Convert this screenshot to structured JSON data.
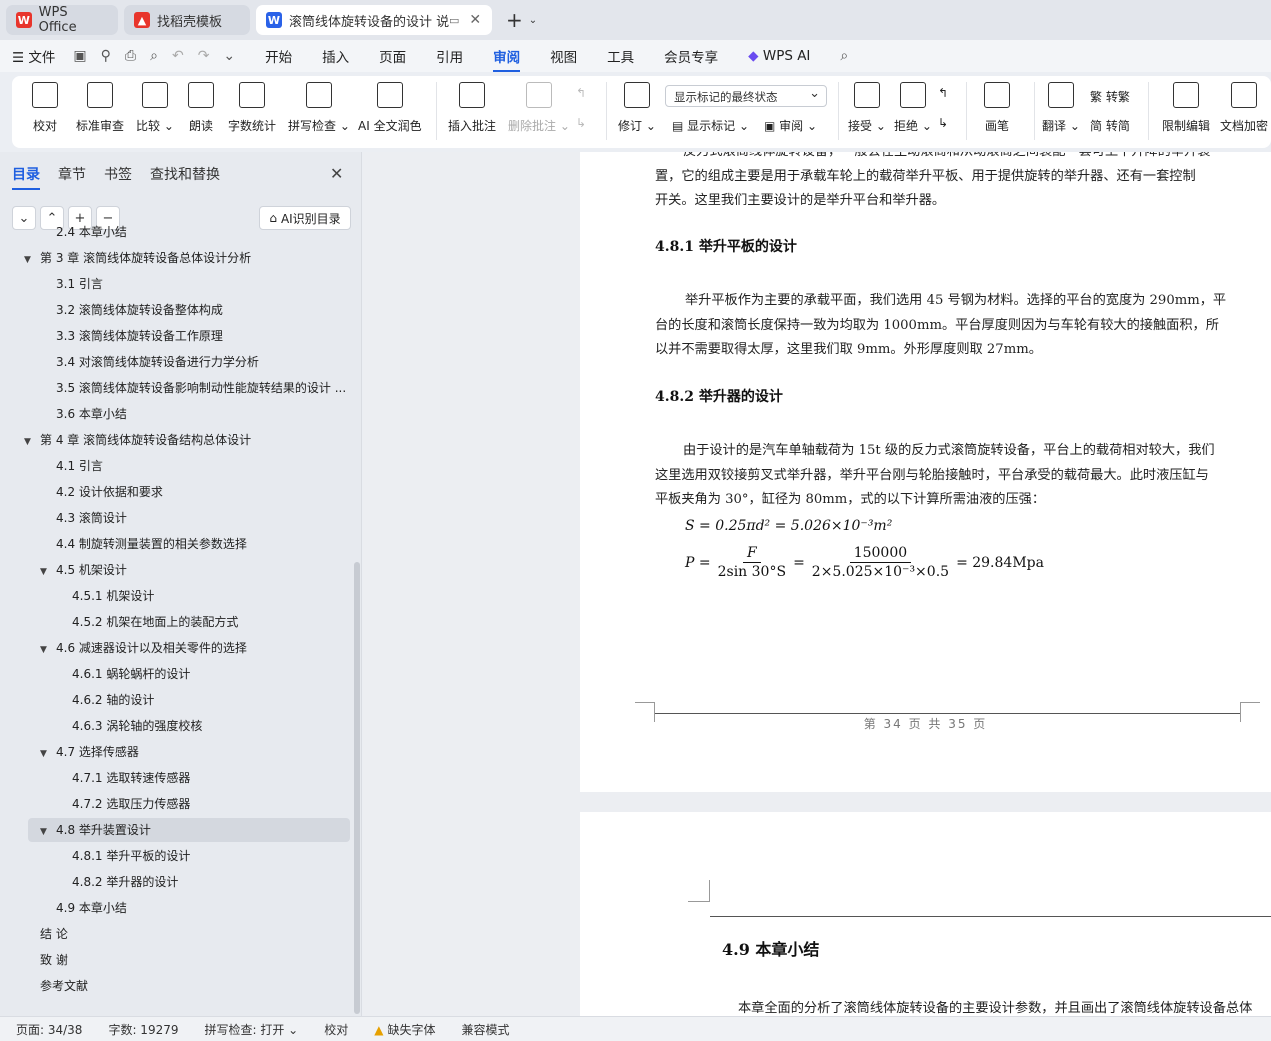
{
  "tabs": [
    {
      "label": "WPS Office",
      "icon": "wps-logo-icon",
      "color": "#e8352c"
    },
    {
      "label": "找稻壳模板",
      "icon": "docer-logo-icon",
      "color": "#e8352c"
    },
    {
      "label": "滚筒线体旋转设备的设计 说明",
      "icon": "writer-doc-icon",
      "color": "#2a62e8"
    }
  ],
  "menu": {
    "file": "文件",
    "items": [
      "开始",
      "插入",
      "页面",
      "引用",
      "审阅",
      "视图",
      "工具",
      "会员专享",
      "WPS AI"
    ],
    "active": "审阅"
  },
  "ribbon": {
    "buttons": [
      "校对",
      "标准审查",
      "比较",
      "朗读",
      "字数统计",
      "拼写检查",
      "AI 全文润色",
      "插入批注",
      "删除批注",
      "修订",
      "画笔",
      "限制编辑",
      "文档加密"
    ],
    "markup_combo": "显示标记的最终状态",
    "show_markup": "显示标记",
    "review": "审阅",
    "accept": "接受",
    "reject": "拒绝",
    "translate": "翻译",
    "to_traditional": "转繁",
    "to_simplified": "转简"
  },
  "sidebar": {
    "tabs": [
      "目录",
      "章节",
      "书签",
      "查找和替换"
    ],
    "ai_toc": "AI识别目录",
    "toc": [
      {
        "text": "2.4 本章小结",
        "level": 2,
        "arrow": ""
      },
      {
        "text": "第 3 章   滚筒线体旋转设备总体设计分析",
        "level": 1,
        "arrow": "▼"
      },
      {
        "text": "3.1 引言",
        "level": 2,
        "arrow": ""
      },
      {
        "text": "3.2 滚筒线体旋转设备整体构成",
        "level": 2,
        "arrow": ""
      },
      {
        "text": "3.3 滚筒线体旋转设备工作原理",
        "level": 2,
        "arrow": ""
      },
      {
        "text": "3.4 对滚筒线体旋转设备进行力学分析",
        "level": 2,
        "arrow": ""
      },
      {
        "text": "3.5 滚筒线体旋转设备影响制动性能旋转结果的设计 ...",
        "level": 2,
        "arrow": ""
      },
      {
        "text": "3.6 本章小结",
        "level": 2,
        "arrow": ""
      },
      {
        "text": "第 4 章  滚筒线体旋转设备结构总体设计",
        "level": 1,
        "arrow": "▼"
      },
      {
        "text": "4.1 引言",
        "level": 2,
        "arrow": ""
      },
      {
        "text": "4.2 设计依据和要求",
        "level": 2,
        "arrow": ""
      },
      {
        "text": "4.3 滚筒设计",
        "level": 2,
        "arrow": ""
      },
      {
        "text": "4.4 制旋转测量装置的相关参数选择",
        "level": 2,
        "arrow": ""
      },
      {
        "text": "4.5 机架设计",
        "level": 2,
        "arrow": "▼"
      },
      {
        "text": "4.5.1 机架设计",
        "level": 3,
        "arrow": ""
      },
      {
        "text": "4.5.2 机架在地面上的装配方式",
        "level": 3,
        "arrow": ""
      },
      {
        "text": "4.6 减速器设计以及相关零件的选择",
        "level": 2,
        "arrow": "▼"
      },
      {
        "text": "4.6.1 蜗轮蜗杆的设计",
        "level": 3,
        "arrow": ""
      },
      {
        "text": "4.6.2 轴的设计",
        "level": 3,
        "arrow": ""
      },
      {
        "text": "4.6.3 涡轮轴的强度校核",
        "level": 3,
        "arrow": ""
      },
      {
        "text": "4.7 选择传感器",
        "level": 2,
        "arrow": "▼"
      },
      {
        "text": "4.7.1 选取转速传感器",
        "level": 3,
        "arrow": ""
      },
      {
        "text": "4.7.2 选取压力传感器",
        "level": 3,
        "arrow": ""
      },
      {
        "text": "4.8 举升装置设计",
        "level": 2,
        "arrow": "▼",
        "selected": true
      },
      {
        "text": "4.8.1 举升平板的设计",
        "level": 3,
        "arrow": ""
      },
      {
        "text": "4.8.2 举升器的设计",
        "level": 3,
        "arrow": ""
      },
      {
        "text": "4.9 本章小结",
        "level": 2,
        "arrow": ""
      },
      {
        "text": "结      论",
        "level": 1,
        "arrow": ""
      },
      {
        "text": "致      谢",
        "level": 1,
        "arrow": ""
      },
      {
        "text": "参考文献",
        "level": 1,
        "arrow": ""
      }
    ]
  },
  "document": {
    "para_top": [
      "反力式滚筒线体旋转设备，一般会在主动滚筒和从动滚筒之间装配一套可上下升降的举升装",
      "置，它的组成主要是用于承载车轮上的载荷举升平板、用于提供旋转的举升器、还有一套控制",
      "开关。这里我们主要设计的是举升平台和举升器。"
    ],
    "h481": "4.8.1  举升平板的设计",
    "para_481": [
      "举升平板作为主要的承载平面，我们选用 45 号钢为材料。选择的平台的宽度为 290mm，平",
      "台的长度和滚筒长度保持一致为均取为 1000mm。平台厚度则因为与车轮有较大的接触面积，所",
      "以并不需要取得太厚，这里我们取 9mm。外形厚度则取 27mm。"
    ],
    "h482": "4.8.2  举升器的设计",
    "para_482": [
      "由于设计的是汽车单轴载荷为 15t 级的反力式滚筒旋转设备，平台上的载荷相对较大，我们",
      "这里选用双铰接剪叉式举升器，举升平台刚与轮胎接触时，平台承受的载荷最大。此时液压缸与",
      "平板夹角为 30°，缸径为 80mm，式的以下计算所需油液的压强："
    ],
    "formula1": "S = 0.25πd² = 5.026×10⁻³m²",
    "formula2_lhs": "P =",
    "formula2_frac1_num": "F",
    "formula2_frac1_den": "2sin 30°S",
    "formula2_frac2_num": "150000",
    "formula2_frac2_den": "2×5.025×10⁻³×0.5",
    "formula2_result": "= 29.84Mpa",
    "footer": "第 34 页 共 35 页",
    "h49": "4.9  本章小结",
    "para_49": "本章全面的分析了滚筒线体旋转设备的主要设计参数，并且画出了滚筒线体旋转设备总体"
  },
  "status": {
    "page": "页面: 34/38",
    "words": "字数: 19279",
    "spell": "拼写检查: 打开",
    "proof": "校对",
    "missing_font": "缺失字体",
    "compat": "兼容模式"
  },
  "colors": {
    "accent": "#1f5fe0",
    "warn": "#e6a000"
  }
}
